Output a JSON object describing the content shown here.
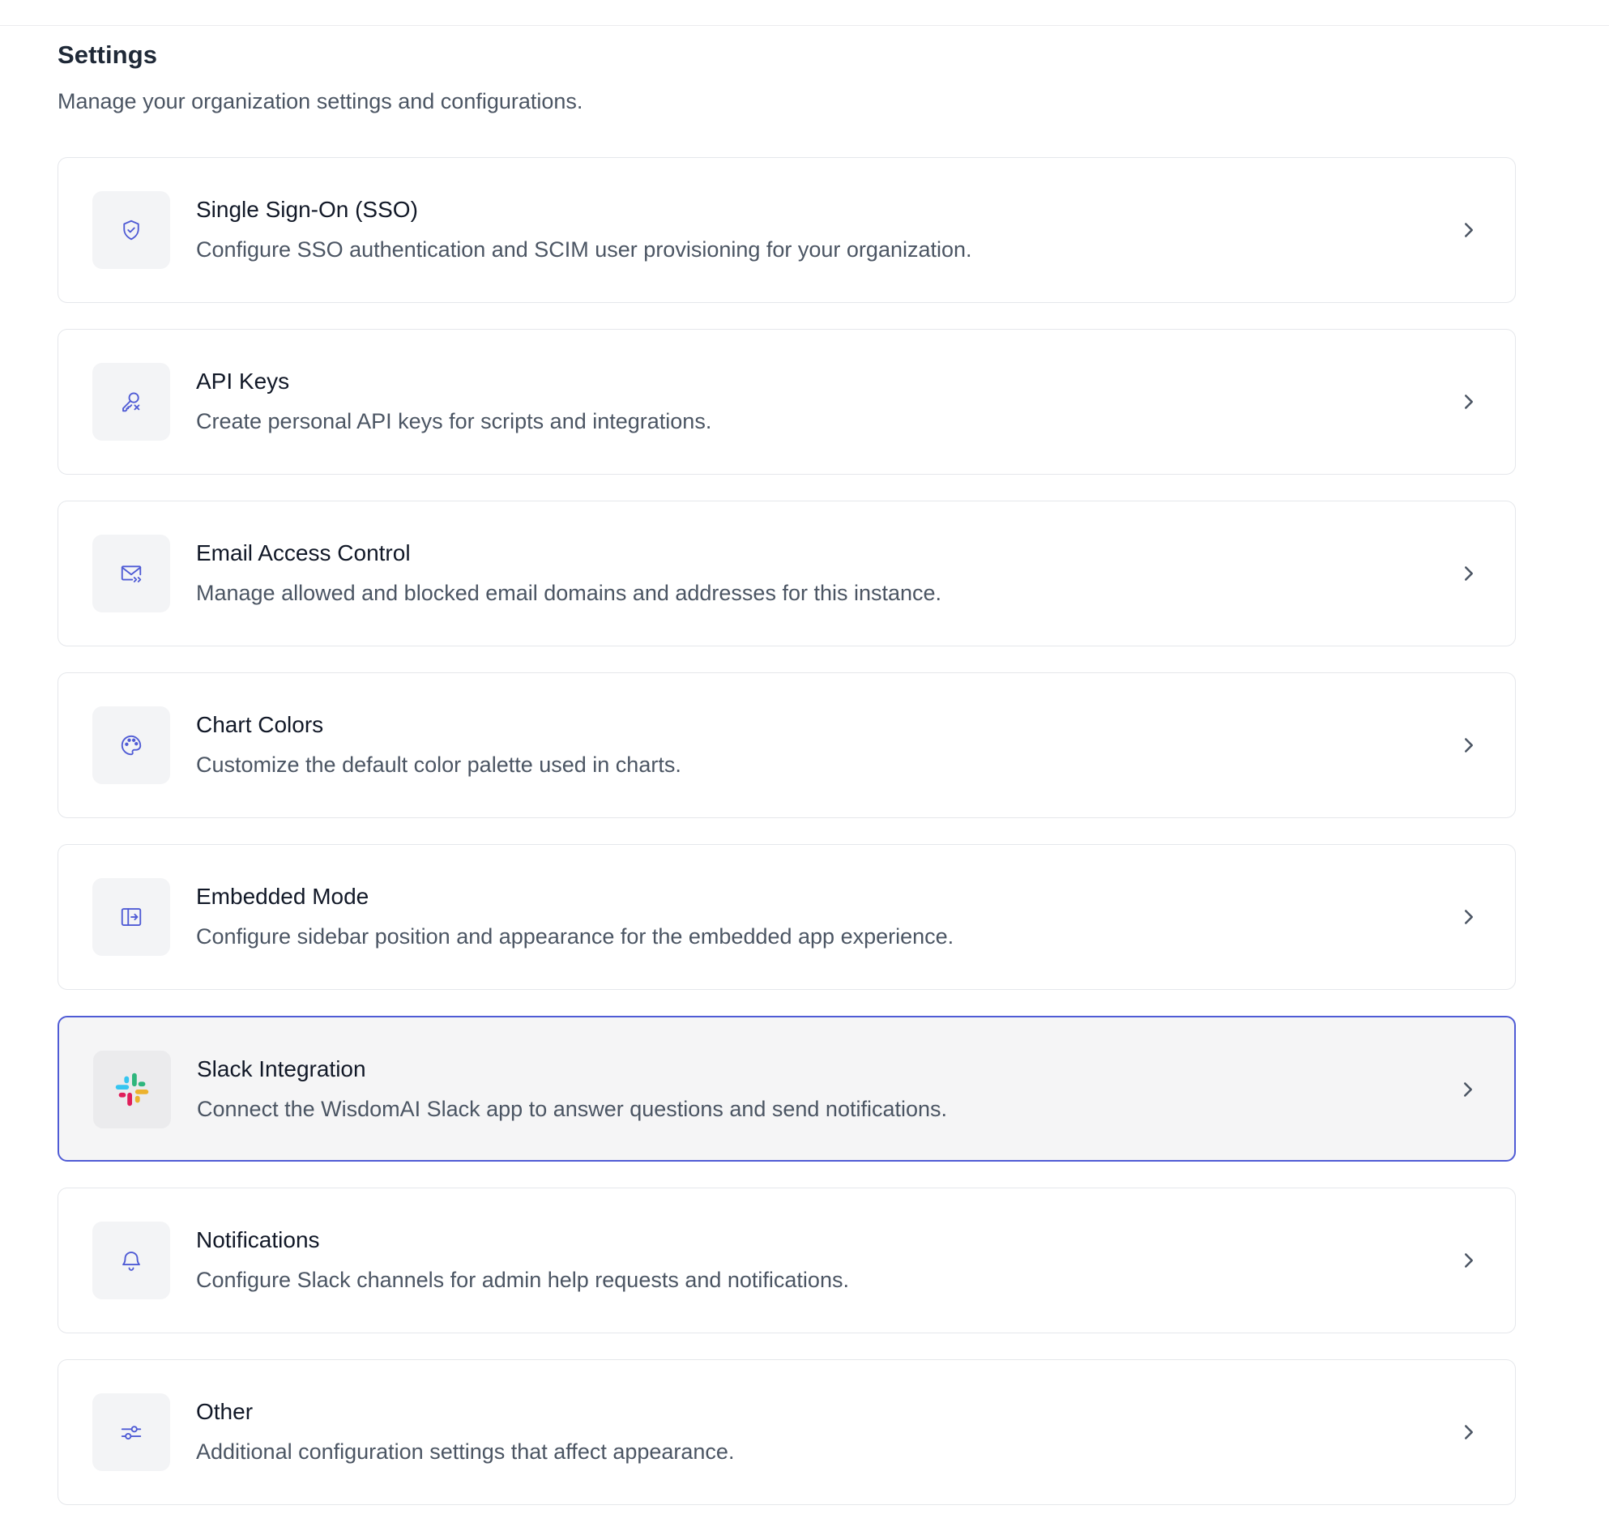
{
  "header": {
    "title": "Settings",
    "subtitle": "Manage your organization settings and configurations."
  },
  "colors": {
    "accent": "#4f5bd5",
    "icon": "#4f5bd5",
    "slack_blue": "#36C5F0",
    "slack_green": "#2EB67D",
    "slack_yellow": "#ECB22E",
    "slack_red": "#E01E5A"
  },
  "cards": [
    {
      "id": "sso",
      "icon": "shield-check-icon",
      "title": "Single Sign-On (SSO)",
      "description": "Configure SSO authentication and SCIM user provisioning for your organization."
    },
    {
      "id": "api-keys",
      "icon": "key-icon",
      "title": "API Keys",
      "description": "Create personal API keys for scripts and integrations."
    },
    {
      "id": "email-access-control",
      "icon": "mail-forward-icon",
      "title": "Email Access Control",
      "description": "Manage allowed and blocked email domains and addresses for this instance."
    },
    {
      "id": "chart-colors",
      "icon": "palette-icon",
      "title": "Chart Colors",
      "description": "Customize the default color palette used in charts."
    },
    {
      "id": "embedded-mode",
      "icon": "sidebar-enter-icon",
      "title": "Embedded Mode",
      "description": "Configure sidebar position and appearance for the embedded app experience."
    },
    {
      "id": "slack-integration",
      "icon": "slack-logo-icon",
      "title": "Slack Integration",
      "description": "Connect the WisdomAI Slack app to answer questions and send notifications.",
      "active": true
    },
    {
      "id": "notifications",
      "icon": "bell-icon",
      "title": "Notifications",
      "description": "Configure Slack channels for admin help requests and notifications."
    },
    {
      "id": "other",
      "icon": "sliders-icon",
      "title": "Other",
      "description": "Additional configuration settings that affect appearance."
    }
  ]
}
